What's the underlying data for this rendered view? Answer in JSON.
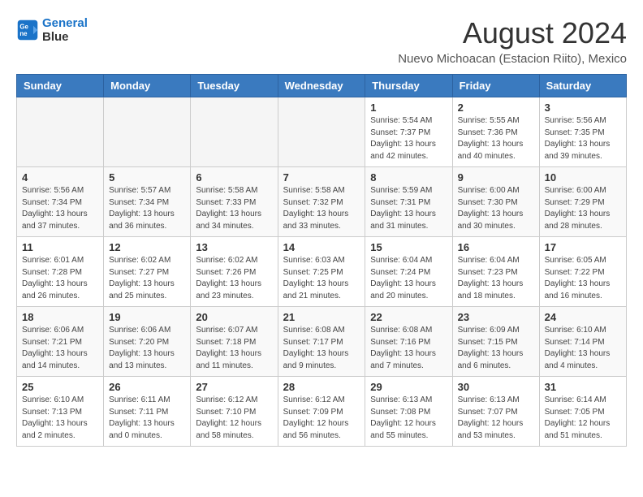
{
  "logo": {
    "line1": "General",
    "line2": "Blue"
  },
  "title": "August 2024",
  "location": "Nuevo Michoacan (Estacion Riito), Mexico",
  "weekdays": [
    "Sunday",
    "Monday",
    "Tuesday",
    "Wednesday",
    "Thursday",
    "Friday",
    "Saturday"
  ],
  "weeks": [
    [
      {
        "day": "",
        "detail": ""
      },
      {
        "day": "",
        "detail": ""
      },
      {
        "day": "",
        "detail": ""
      },
      {
        "day": "",
        "detail": ""
      },
      {
        "day": "1",
        "detail": "Sunrise: 5:54 AM\nSunset: 7:37 PM\nDaylight: 13 hours\nand 42 minutes."
      },
      {
        "day": "2",
        "detail": "Sunrise: 5:55 AM\nSunset: 7:36 PM\nDaylight: 13 hours\nand 40 minutes."
      },
      {
        "day": "3",
        "detail": "Sunrise: 5:56 AM\nSunset: 7:35 PM\nDaylight: 13 hours\nand 39 minutes."
      }
    ],
    [
      {
        "day": "4",
        "detail": "Sunrise: 5:56 AM\nSunset: 7:34 PM\nDaylight: 13 hours\nand 37 minutes."
      },
      {
        "day": "5",
        "detail": "Sunrise: 5:57 AM\nSunset: 7:34 PM\nDaylight: 13 hours\nand 36 minutes."
      },
      {
        "day": "6",
        "detail": "Sunrise: 5:58 AM\nSunset: 7:33 PM\nDaylight: 13 hours\nand 34 minutes."
      },
      {
        "day": "7",
        "detail": "Sunrise: 5:58 AM\nSunset: 7:32 PM\nDaylight: 13 hours\nand 33 minutes."
      },
      {
        "day": "8",
        "detail": "Sunrise: 5:59 AM\nSunset: 7:31 PM\nDaylight: 13 hours\nand 31 minutes."
      },
      {
        "day": "9",
        "detail": "Sunrise: 6:00 AM\nSunset: 7:30 PM\nDaylight: 13 hours\nand 30 minutes."
      },
      {
        "day": "10",
        "detail": "Sunrise: 6:00 AM\nSunset: 7:29 PM\nDaylight: 13 hours\nand 28 minutes."
      }
    ],
    [
      {
        "day": "11",
        "detail": "Sunrise: 6:01 AM\nSunset: 7:28 PM\nDaylight: 13 hours\nand 26 minutes."
      },
      {
        "day": "12",
        "detail": "Sunrise: 6:02 AM\nSunset: 7:27 PM\nDaylight: 13 hours\nand 25 minutes."
      },
      {
        "day": "13",
        "detail": "Sunrise: 6:02 AM\nSunset: 7:26 PM\nDaylight: 13 hours\nand 23 minutes."
      },
      {
        "day": "14",
        "detail": "Sunrise: 6:03 AM\nSunset: 7:25 PM\nDaylight: 13 hours\nand 21 minutes."
      },
      {
        "day": "15",
        "detail": "Sunrise: 6:04 AM\nSunset: 7:24 PM\nDaylight: 13 hours\nand 20 minutes."
      },
      {
        "day": "16",
        "detail": "Sunrise: 6:04 AM\nSunset: 7:23 PM\nDaylight: 13 hours\nand 18 minutes."
      },
      {
        "day": "17",
        "detail": "Sunrise: 6:05 AM\nSunset: 7:22 PM\nDaylight: 13 hours\nand 16 minutes."
      }
    ],
    [
      {
        "day": "18",
        "detail": "Sunrise: 6:06 AM\nSunset: 7:21 PM\nDaylight: 13 hours\nand 14 minutes."
      },
      {
        "day": "19",
        "detail": "Sunrise: 6:06 AM\nSunset: 7:20 PM\nDaylight: 13 hours\nand 13 minutes."
      },
      {
        "day": "20",
        "detail": "Sunrise: 6:07 AM\nSunset: 7:18 PM\nDaylight: 13 hours\nand 11 minutes."
      },
      {
        "day": "21",
        "detail": "Sunrise: 6:08 AM\nSunset: 7:17 PM\nDaylight: 13 hours\nand 9 minutes."
      },
      {
        "day": "22",
        "detail": "Sunrise: 6:08 AM\nSunset: 7:16 PM\nDaylight: 13 hours\nand 7 minutes."
      },
      {
        "day": "23",
        "detail": "Sunrise: 6:09 AM\nSunset: 7:15 PM\nDaylight: 13 hours\nand 6 minutes."
      },
      {
        "day": "24",
        "detail": "Sunrise: 6:10 AM\nSunset: 7:14 PM\nDaylight: 13 hours\nand 4 minutes."
      }
    ],
    [
      {
        "day": "25",
        "detail": "Sunrise: 6:10 AM\nSunset: 7:13 PM\nDaylight: 13 hours\nand 2 minutes."
      },
      {
        "day": "26",
        "detail": "Sunrise: 6:11 AM\nSunset: 7:11 PM\nDaylight: 13 hours\nand 0 minutes."
      },
      {
        "day": "27",
        "detail": "Sunrise: 6:12 AM\nSunset: 7:10 PM\nDaylight: 12 hours\nand 58 minutes."
      },
      {
        "day": "28",
        "detail": "Sunrise: 6:12 AM\nSunset: 7:09 PM\nDaylight: 12 hours\nand 56 minutes."
      },
      {
        "day": "29",
        "detail": "Sunrise: 6:13 AM\nSunset: 7:08 PM\nDaylight: 12 hours\nand 55 minutes."
      },
      {
        "day": "30",
        "detail": "Sunrise: 6:13 AM\nSunset: 7:07 PM\nDaylight: 12 hours\nand 53 minutes."
      },
      {
        "day": "31",
        "detail": "Sunrise: 6:14 AM\nSunset: 7:05 PM\nDaylight: 12 hours\nand 51 minutes."
      }
    ]
  ]
}
